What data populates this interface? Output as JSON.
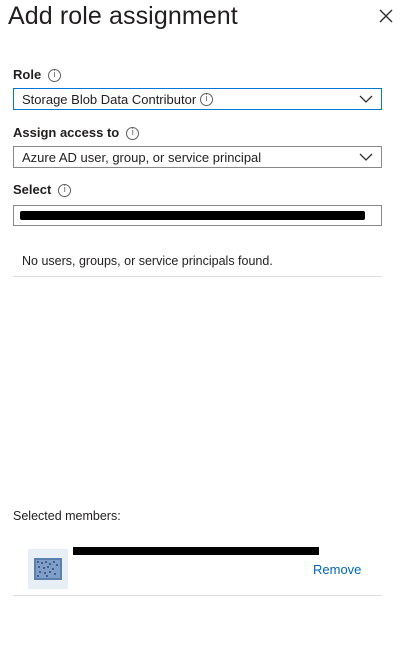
{
  "panel": {
    "title": "Add role assignment"
  },
  "role": {
    "label": "Role",
    "value": "Storage Blob Data Contributor"
  },
  "assign_access": {
    "label": "Assign access to",
    "value": "Azure AD user, group, or service principal"
  },
  "select": {
    "label": "Select",
    "value_redacted": true
  },
  "results": {
    "empty_message": "No users, groups, or service principals found."
  },
  "selected_members": {
    "label": "Selected members:",
    "items": [
      {
        "name_redacted": true,
        "remove_label": "Remove"
      }
    ]
  },
  "colors": {
    "focus_border": "#0078d4",
    "link": "#0067b8",
    "border": "#8a8886",
    "divider": "#e1dfdd"
  },
  "icons": [
    "close-icon",
    "info-icon",
    "chevron-down-icon",
    "avatar-icon"
  ]
}
